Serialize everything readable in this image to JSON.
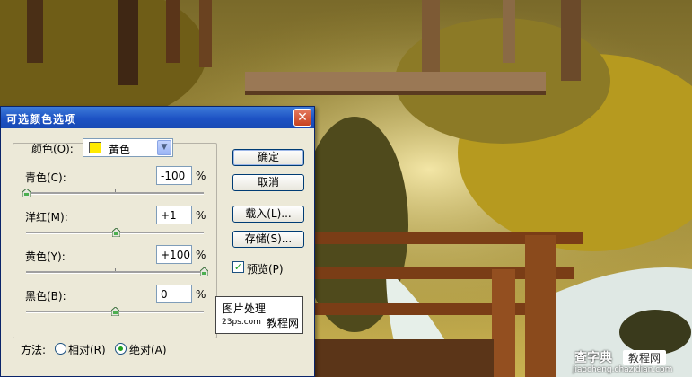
{
  "dialog": {
    "title": "可选颜色选项",
    "color_label": "颜色(O):",
    "color_value": "黄色",
    "sliders": [
      {
        "label": "青色(C):",
        "value": "-100",
        "unit": "%",
        "level": 0.0
      },
      {
        "label": "洋红(M):",
        "value": "+1",
        "unit": "%",
        "level": 0.505
      },
      {
        "label": "黄色(Y):",
        "value": "+100",
        "unit": "%",
        "level": 1.0
      },
      {
        "label": "黑色(B):",
        "value": "0",
        "unit": "%",
        "level": 0.5
      }
    ],
    "buttons": {
      "ok": "确定",
      "cancel": "取消",
      "load": "载入(L)...",
      "save": "存储(S)..."
    },
    "preview_label": "预览(P)",
    "preview_checked": true,
    "method_label": "方法:",
    "method_options": [
      {
        "label": "相对(R)",
        "selected": false
      },
      {
        "label": "绝对(A)",
        "selected": true
      }
    ]
  },
  "watermark": {
    "line1": "图片处理",
    "line2a": "23ps.com",
    "line2b": "教程网"
  },
  "site_mark": {
    "brand": "查字典",
    "badge": "教程网",
    "url": "jiaocheng.chazidian.com"
  },
  "colors": {
    "swatch": "#ffea00",
    "title_bar": "#1d52c4",
    "dialog_bg": "#ece9d8"
  }
}
